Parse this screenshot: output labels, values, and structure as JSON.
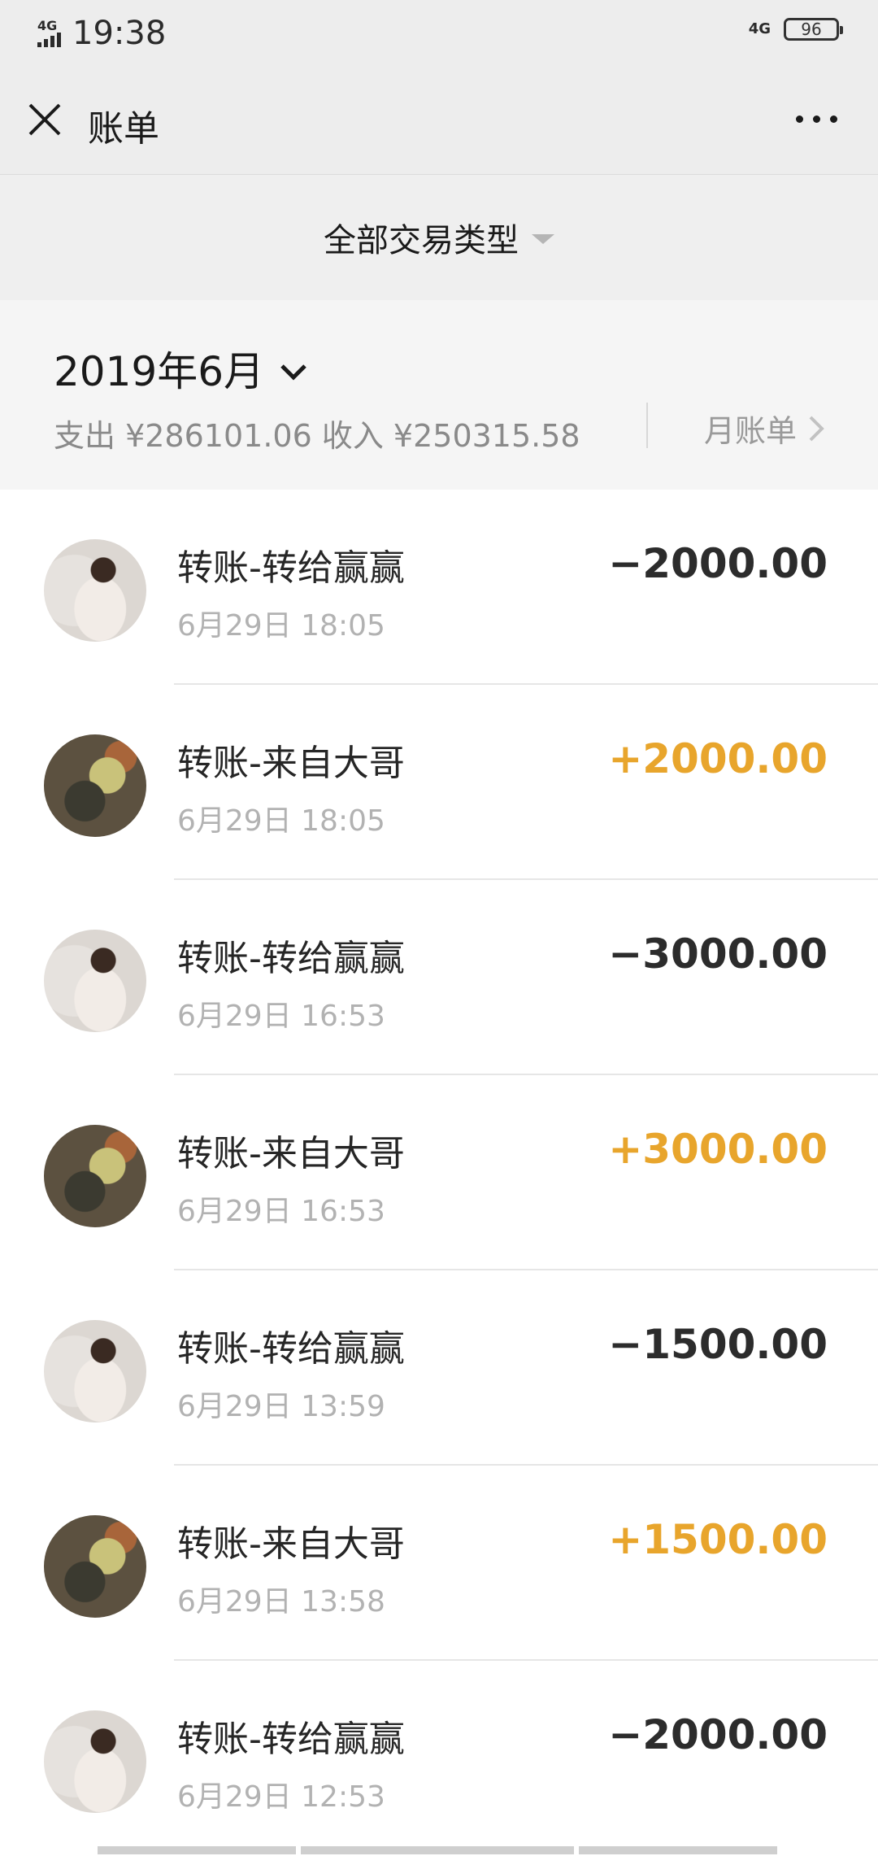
{
  "status_bar": {
    "network_left": "4G",
    "time": "19:38",
    "network_right": "4G",
    "battery": "96"
  },
  "nav": {
    "title": "账单",
    "close_icon": "close-icon",
    "more_icon": "more-icon"
  },
  "filter": {
    "label": "全部交易类型"
  },
  "month": {
    "title": "2019年6月",
    "summary": "支出 ¥286101.06 收入 ¥250315.58",
    "bill_link": "月账单"
  },
  "transactions": [
    {
      "title": "转账-转给赢赢",
      "time": "6月29日 18:05",
      "amount": "−2000.00",
      "type": "expense"
    },
    {
      "title": "转账-来自大哥",
      "time": "6月29日 18:05",
      "amount": "+2000.00",
      "type": "income"
    },
    {
      "title": "转账-转给赢赢",
      "time": "6月29日 16:53",
      "amount": "−3000.00",
      "type": "expense"
    },
    {
      "title": "转账-来自大哥",
      "time": "6月29日 16:53",
      "amount": "+3000.00",
      "type": "income"
    },
    {
      "title": "转账-转给赢赢",
      "time": "6月29日 13:59",
      "amount": "−1500.00",
      "type": "expense"
    },
    {
      "title": "转账-来自大哥",
      "time": "6月29日 13:58",
      "amount": "+1500.00",
      "type": "income"
    },
    {
      "title": "转账-转给赢赢",
      "time": "6月29日 12:53",
      "amount": "−2000.00",
      "type": "expense"
    }
  ],
  "colors": {
    "income": "#e8a52c",
    "expense": "#2c2c2c"
  }
}
